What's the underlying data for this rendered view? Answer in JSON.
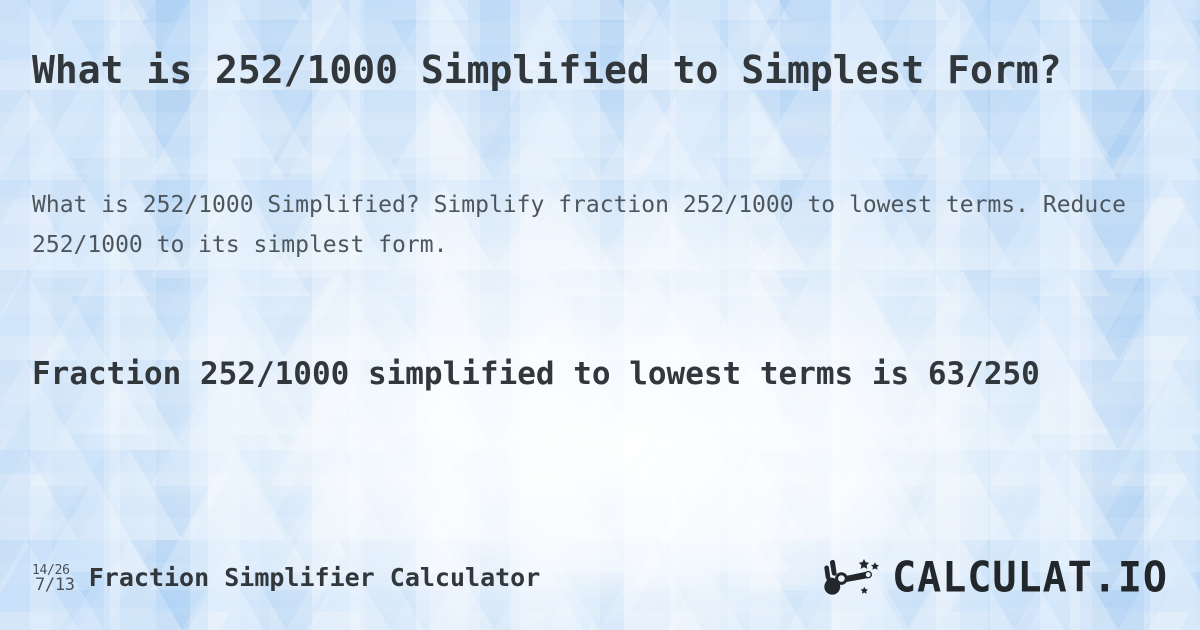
{
  "page": {
    "title": "What is 252/1000 Simplified to Simplest Form?",
    "subtitle": "What is 252/1000 Simplified? Simplify fraction 252/1000 to lowest terms. Reduce 252/1000 to its simplest form.",
    "result": "Fraction 252/1000 simplified to lowest terms is 63/250"
  },
  "fraction": {
    "numerator": "252",
    "denominator": "1000",
    "original": "252/1000",
    "simplified": "63/250",
    "simplified_numerator": "63",
    "simplified_denominator": "250"
  },
  "footer": {
    "label": "Fraction Simplifier Calculator",
    "icon": {
      "name": "fraction-reduce-icon",
      "top": "14/26",
      "bottom": "7/13"
    },
    "logo": {
      "icon_name": "magic-wand-hand-icon",
      "text": "CALCULAT.IO"
    }
  },
  "colors": {
    "background_blue": "#a8cdf2",
    "background_light": "#f4f9fe",
    "heading_text": "#32373b",
    "body_text": "#4e565d",
    "logo_text": "#22272b"
  }
}
